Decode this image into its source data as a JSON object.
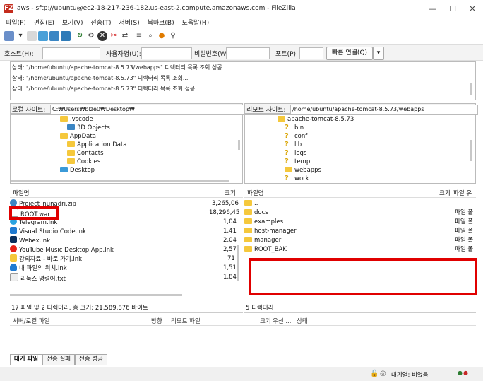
{
  "window": {
    "title": "aws - sftp://ubuntu@ec2-18-217-236-182.us-east-2.compute.amazonaws.com - FileZilla",
    "logo": "FZ"
  },
  "menu": [
    "파일(F)",
    "편집(E)",
    "보기(V)",
    "전송(T)",
    "서버(S)",
    "북마크(B)",
    "도움말(H)"
  ],
  "quickconnect": {
    "host_label": "호스트(H):",
    "user_label": "사용자명(U):",
    "pass_label": "비밀번호(W):",
    "port_label": "포트(P):",
    "connect_label": "빠른 연결(Q)",
    "dropdown": "▾"
  },
  "log": [
    "상태: \"/home/ubuntu/apache-tomcat-8.5.73/webapps\" 디렉터리 목록 조회 성공",
    "상태: \"/home/ubuntu/apache-tomcat-8.5.73\" 디렉터리 목록 조회...",
    "상태: \"/home/ubuntu/apache-tomcat-8.5.73\" 디렉터리 목록 조회 성공"
  ],
  "local": {
    "site_label": "로컬 사이트:",
    "site_path": "C:₩Users₩blze0₩Desktop₩",
    "tree": [
      ".vscode",
      "3D Objects",
      "AppData",
      "Application Data",
      "Contacts",
      "Cookies",
      "Desktop"
    ],
    "col_name": "파일명",
    "col_size": "크기",
    "files": [
      {
        "name": "Project_nunadri.zip",
        "size": "3,265,06"
      },
      {
        "name": "ROOT.war",
        "size": "18,296,45"
      },
      {
        "name": "Telegram.lnk",
        "size": "1,04"
      },
      {
        "name": "Visual Studio Code.lnk",
        "size": "1,41"
      },
      {
        "name": "Webex.lnk",
        "size": "2,04"
      },
      {
        "name": "YouTube Music Desktop App.lnk",
        "size": "2,57"
      },
      {
        "name": "강의자료 - 바로 가기.lnk",
        "size": "71"
      },
      {
        "name": "내 파일의 위치.lnk",
        "size": "1,51"
      },
      {
        "name": "리눅스 명령어.txt",
        "size": "1,84"
      }
    ],
    "status": "17 파일 및 2 디렉터리. 총 크기: 21,589,876 바이트"
  },
  "remote": {
    "site_label": "리모트 사이트:",
    "site_path": "/home/ubuntu/apache-tomcat-8.5.73/webapps",
    "tree": [
      "apache-tomcat-8.5.73",
      "bin",
      "conf",
      "lib",
      "logs",
      "temp",
      "webapps",
      "work"
    ],
    "col_name": "파일명",
    "col_size": "크기",
    "col_type": "파일 유",
    "files": [
      {
        "name": "..",
        "type": ""
      },
      {
        "name": "docs",
        "type": "파일 폴"
      },
      {
        "name": "examples",
        "type": "파일 폴"
      },
      {
        "name": "host-manager",
        "type": "파일 폴"
      },
      {
        "name": "manager",
        "type": "파일 폴"
      },
      {
        "name": "ROOT_BAK",
        "type": "파일 폴"
      }
    ],
    "status": "5 디렉터리"
  },
  "queue": {
    "col_server": "서버/로컬 파일",
    "col_dir": "방향",
    "col_remote": "리모트 파일",
    "col_size": "크기",
    "col_priority": "우선 ...",
    "col_status": "상태"
  },
  "tabs": [
    "대기 파일",
    "전송 실패",
    "전송 성공"
  ],
  "statusbar": {
    "queue": "대기열: 비었음"
  },
  "colors": {
    "highlight_red": "#e00000",
    "folder": "#f5c83c"
  }
}
